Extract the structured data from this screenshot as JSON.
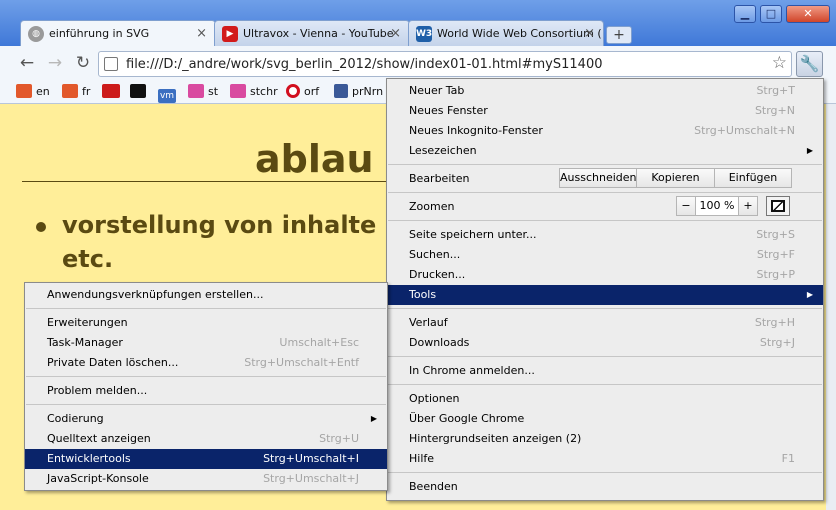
{
  "window": {
    "controls": {
      "minimize": "▁",
      "maximize": "□",
      "close": "✕"
    }
  },
  "tabs": [
    {
      "title": "einführung in SVG",
      "icon": "globe-icon",
      "close": "×"
    },
    {
      "title": "Ultravox - Vienna - YouTube",
      "icon": "youtube-icon",
      "close": "×"
    },
    {
      "title": "World Wide Web Consortium (",
      "icon": "w3c-icon",
      "favicon_text": "W3",
      "close": "×"
    }
  ],
  "new_tab": "+",
  "toolbar": {
    "back": "←",
    "forward": "→",
    "reload": "↻",
    "url": "file:///D:/_andre/work/svg_berlin_2012/show/index01-01.html#myS11400",
    "star": "☆",
    "wrench": "🔧"
  },
  "bookmarks": [
    {
      "label": "en",
      "icon": "flag-icon",
      "color": "#e2582b"
    },
    {
      "label": "fr",
      "icon": "flag-icon",
      "color": "#e2582b"
    },
    {
      "label": "",
      "icon": "red-logo-icon",
      "color": "#cc1b1b"
    },
    {
      "label": "",
      "icon": "black-logo-icon",
      "color": "#111111"
    },
    {
      "label": "",
      "icon": "vm-icon",
      "color": "#3b6fc1",
      "text": "vm"
    },
    {
      "label": "st",
      "icon": "home-icon",
      "color": "#d94aa0"
    },
    {
      "label": "stchr",
      "icon": "home-icon",
      "color": "#d94aa0"
    },
    {
      "label": "orf",
      "icon": "orf-icon",
      "color": "#d20f1f"
    },
    {
      "label": "prNrn",
      "icon": "facebook-icon",
      "color": "#3b5998"
    }
  ],
  "page": {
    "heading": "ablau",
    "bullet_line1": "vorstellung von inhalte",
    "bullet_line2": "etc."
  },
  "chrome_menu": {
    "new_tab": {
      "label": "Neuer Tab",
      "shortcut": "Strg+T"
    },
    "new_window": {
      "label": "Neues Fenster",
      "shortcut": "Strg+N"
    },
    "incognito": {
      "label": "Neues Inkognito-Fenster",
      "shortcut": "Strg+Umschalt+N"
    },
    "bookmarks": {
      "label": "Lesezeichen"
    },
    "edit": {
      "label": "Bearbeiten",
      "cut": "Ausschneiden",
      "copy": "Kopieren",
      "paste": "Einfügen"
    },
    "zoom": {
      "label": "Zoomen",
      "minus": "−",
      "level": "100 %",
      "plus": "+"
    },
    "save_page": {
      "label": "Seite speichern unter...",
      "shortcut": "Strg+S"
    },
    "find": {
      "label": "Suchen...",
      "shortcut": "Strg+F"
    },
    "print": {
      "label": "Drucken...",
      "shortcut": "Strg+P"
    },
    "tools": {
      "label": "Tools"
    },
    "history": {
      "label": "Verlauf",
      "shortcut": "Strg+H"
    },
    "downloads": {
      "label": "Downloads",
      "shortcut": "Strg+J"
    },
    "sign_in": {
      "label": "In Chrome anmelden..."
    },
    "options": {
      "label": "Optionen"
    },
    "about": {
      "label": "Über Google Chrome"
    },
    "background_pages": {
      "label": "Hintergrundseiten anzeigen (2)"
    },
    "help": {
      "label": "Hilfe",
      "shortcut": "F1"
    },
    "exit": {
      "label": "Beenden"
    }
  },
  "tools_menu": {
    "create_shortcuts": {
      "label": "Anwendungsverknüpfungen erstellen..."
    },
    "extensions": {
      "label": "Erweiterungen"
    },
    "task_manager": {
      "label": "Task-Manager",
      "shortcut": "Umschalt+Esc"
    },
    "clear_data": {
      "label": "Private Daten löschen...",
      "shortcut": "Strg+Umschalt+Entf"
    },
    "report_issue": {
      "label": "Problem melden..."
    },
    "encoding": {
      "label": "Codierung"
    },
    "view_source": {
      "label": "Quelltext anzeigen",
      "shortcut": "Strg+U"
    },
    "dev_tools": {
      "label": "Entwicklertools",
      "shortcut": "Strg+Umschalt+I"
    },
    "js_console": {
      "label": "JavaScript-Konsole",
      "shortcut": "Strg+Umschalt+J"
    }
  }
}
